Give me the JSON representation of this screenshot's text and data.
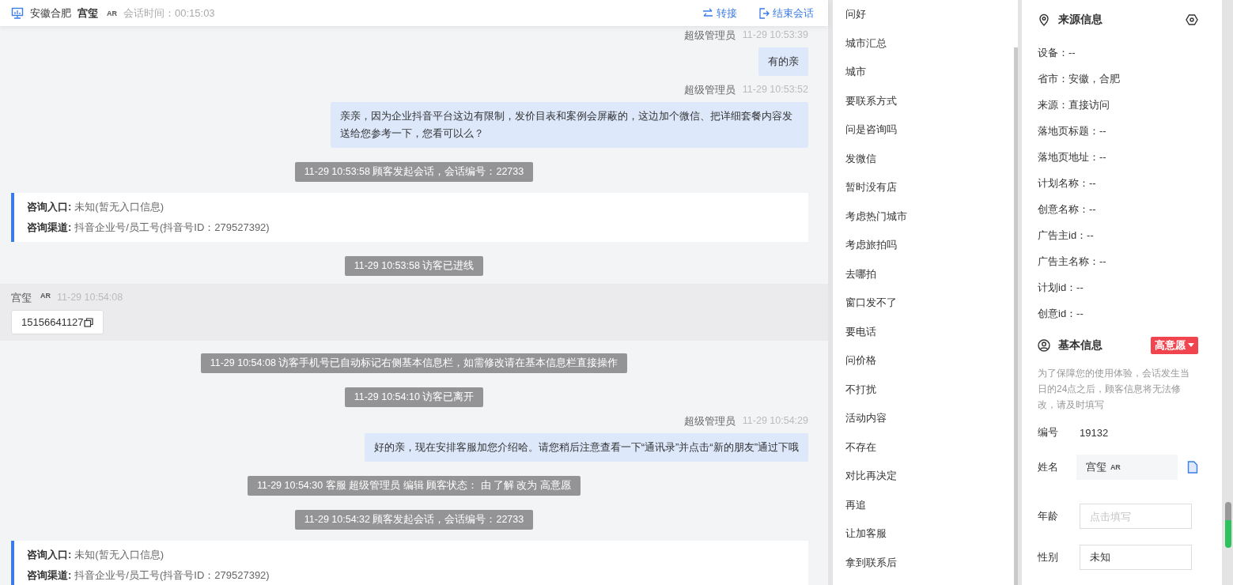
{
  "header": {
    "location": "安徽合肥",
    "visitor_name": "宫玺",
    "visitor_tag": "AR",
    "duration": "会话时间：00:15:03",
    "actions": [
      {
        "label": "转接",
        "kind": "transfer"
      },
      {
        "label": "结束会话",
        "kind": "end"
      }
    ]
  },
  "messages": [
    {
      "kind": "agent",
      "sender": "超级管理员",
      "time": "11-29 10:53:39",
      "text": "有的亲"
    },
    {
      "kind": "agent",
      "sender": "超级管理员",
      "time": "11-29 10:53:52",
      "text": "亲亲，因为企业抖音平台这边有限制，发价目表和案例会屏蔽的，这边加个微信、把详细套餐内容发送给您参考一下，您看可以么？"
    },
    {
      "kind": "system",
      "text": "11-29 10:53:58 顾客发起会话，会话编号：22733"
    },
    {
      "kind": "info",
      "rows": [
        {
          "label": "咨询入口:",
          "value": "未知(暂无入口信息)"
        },
        {
          "label": "咨询渠道:",
          "value": "抖音企业号/员工号(抖音号ID：279527392)"
        }
      ]
    },
    {
      "kind": "system",
      "text": "11-29 10:53:58 访客已进线"
    },
    {
      "kind": "visitor",
      "sender": "宫玺",
      "tag": "AR",
      "time": "11-29 10:54:08",
      "text": "15156641127"
    },
    {
      "kind": "system",
      "text": "11-29 10:54:08 访客手机号已自动标记右侧基本信息栏，如需修改请在基本信息栏直接操作"
    },
    {
      "kind": "system",
      "text": "11-29 10:54:10 访客已离开"
    },
    {
      "kind": "agent",
      "sender": "超级管理员",
      "time": "11-29 10:54:29",
      "text": "好的亲，现在安排客服加您介绍哈。请您稍后注意查看一下“通讯录”并点击“新的朋友”通过下哦"
    },
    {
      "kind": "system",
      "text": "11-29 10:54:30 客服 超级管理员 编辑 顾客状态： 由 了解 改为 高意愿"
    },
    {
      "kind": "system",
      "text": "11-29 10:54:32 顾客发起会话，会话编号：22733"
    },
    {
      "kind": "info",
      "rows": [
        {
          "label": "咨询入口:",
          "value": "未知(暂无入口信息)"
        },
        {
          "label": "咨询渠道:",
          "value": "抖音企业号/员工号(抖音号ID：279527392)"
        }
      ]
    }
  ],
  "quick_replies": [
    "问好",
    "城市汇总",
    "城市",
    "要联系方式",
    "问是咨询吗",
    "发微信",
    "暂时没有店",
    "考虑热门城市",
    "考虑旅拍吗",
    "去哪拍",
    "窗口发不了",
    "要电话",
    "问价格",
    "不打扰",
    "活动内容",
    "不存在",
    "对比再决定",
    "再追",
    "让加客服",
    "拿到联系后"
  ],
  "source_info": {
    "title": "来源信息",
    "rows": [
      "设备：--",
      "省市：安徽，合肥",
      "来源：直接访问",
      "落地页标题：--",
      "落地页地址：--",
      "计划名称：--",
      "创意名称：--",
      "广告主id：--",
      "广告主名称：--",
      "计划id：--",
      "创意id：--"
    ]
  },
  "basic_info": {
    "title": "基本信息",
    "status": "高意愿",
    "note": "为了保障您的使用体验，会话发生当日的24点之后，顾客信息将无法修改，请及时填写",
    "fields": [
      {
        "kind": "text",
        "label": "编号",
        "value": "19132"
      },
      {
        "kind": "name",
        "label": "姓名",
        "value": "宫玺",
        "tag": "AR"
      },
      {
        "kind": "input",
        "label": "年龄",
        "placeholder": "点击填写"
      },
      {
        "kind": "input",
        "label": "性别",
        "value": "未知"
      }
    ]
  }
}
